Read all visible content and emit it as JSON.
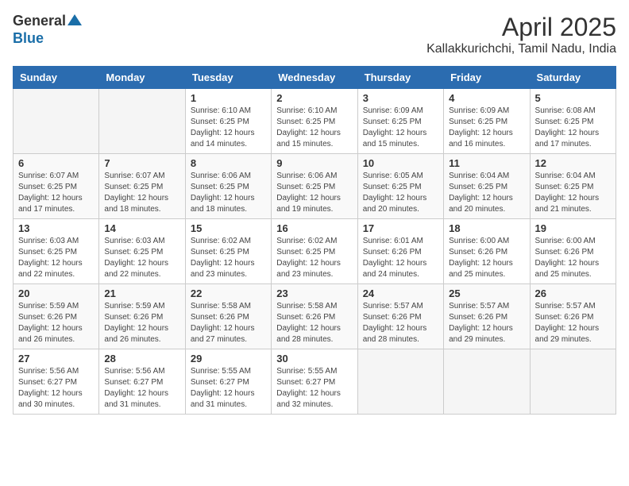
{
  "header": {
    "logo_general": "General",
    "logo_blue": "Blue",
    "month_year": "April 2025",
    "location": "Kallakkurichchi, Tamil Nadu, India"
  },
  "weekdays": [
    "Sunday",
    "Monday",
    "Tuesday",
    "Wednesday",
    "Thursday",
    "Friday",
    "Saturday"
  ],
  "weeks": [
    [
      {
        "day": "",
        "info": ""
      },
      {
        "day": "",
        "info": ""
      },
      {
        "day": "1",
        "info": "Sunrise: 6:10 AM\nSunset: 6:25 PM\nDaylight: 12 hours\nand 14 minutes."
      },
      {
        "day": "2",
        "info": "Sunrise: 6:10 AM\nSunset: 6:25 PM\nDaylight: 12 hours\nand 15 minutes."
      },
      {
        "day": "3",
        "info": "Sunrise: 6:09 AM\nSunset: 6:25 PM\nDaylight: 12 hours\nand 15 minutes."
      },
      {
        "day": "4",
        "info": "Sunrise: 6:09 AM\nSunset: 6:25 PM\nDaylight: 12 hours\nand 16 minutes."
      },
      {
        "day": "5",
        "info": "Sunrise: 6:08 AM\nSunset: 6:25 PM\nDaylight: 12 hours\nand 17 minutes."
      }
    ],
    [
      {
        "day": "6",
        "info": "Sunrise: 6:07 AM\nSunset: 6:25 PM\nDaylight: 12 hours\nand 17 minutes."
      },
      {
        "day": "7",
        "info": "Sunrise: 6:07 AM\nSunset: 6:25 PM\nDaylight: 12 hours\nand 18 minutes."
      },
      {
        "day": "8",
        "info": "Sunrise: 6:06 AM\nSunset: 6:25 PM\nDaylight: 12 hours\nand 18 minutes."
      },
      {
        "day": "9",
        "info": "Sunrise: 6:06 AM\nSunset: 6:25 PM\nDaylight: 12 hours\nand 19 minutes."
      },
      {
        "day": "10",
        "info": "Sunrise: 6:05 AM\nSunset: 6:25 PM\nDaylight: 12 hours\nand 20 minutes."
      },
      {
        "day": "11",
        "info": "Sunrise: 6:04 AM\nSunset: 6:25 PM\nDaylight: 12 hours\nand 20 minutes."
      },
      {
        "day": "12",
        "info": "Sunrise: 6:04 AM\nSunset: 6:25 PM\nDaylight: 12 hours\nand 21 minutes."
      }
    ],
    [
      {
        "day": "13",
        "info": "Sunrise: 6:03 AM\nSunset: 6:25 PM\nDaylight: 12 hours\nand 22 minutes."
      },
      {
        "day": "14",
        "info": "Sunrise: 6:03 AM\nSunset: 6:25 PM\nDaylight: 12 hours\nand 22 minutes."
      },
      {
        "day": "15",
        "info": "Sunrise: 6:02 AM\nSunset: 6:25 PM\nDaylight: 12 hours\nand 23 minutes."
      },
      {
        "day": "16",
        "info": "Sunrise: 6:02 AM\nSunset: 6:25 PM\nDaylight: 12 hours\nand 23 minutes."
      },
      {
        "day": "17",
        "info": "Sunrise: 6:01 AM\nSunset: 6:26 PM\nDaylight: 12 hours\nand 24 minutes."
      },
      {
        "day": "18",
        "info": "Sunrise: 6:00 AM\nSunset: 6:26 PM\nDaylight: 12 hours\nand 25 minutes."
      },
      {
        "day": "19",
        "info": "Sunrise: 6:00 AM\nSunset: 6:26 PM\nDaylight: 12 hours\nand 25 minutes."
      }
    ],
    [
      {
        "day": "20",
        "info": "Sunrise: 5:59 AM\nSunset: 6:26 PM\nDaylight: 12 hours\nand 26 minutes."
      },
      {
        "day": "21",
        "info": "Sunrise: 5:59 AM\nSunset: 6:26 PM\nDaylight: 12 hours\nand 26 minutes."
      },
      {
        "day": "22",
        "info": "Sunrise: 5:58 AM\nSunset: 6:26 PM\nDaylight: 12 hours\nand 27 minutes."
      },
      {
        "day": "23",
        "info": "Sunrise: 5:58 AM\nSunset: 6:26 PM\nDaylight: 12 hours\nand 28 minutes."
      },
      {
        "day": "24",
        "info": "Sunrise: 5:57 AM\nSunset: 6:26 PM\nDaylight: 12 hours\nand 28 minutes."
      },
      {
        "day": "25",
        "info": "Sunrise: 5:57 AM\nSunset: 6:26 PM\nDaylight: 12 hours\nand 29 minutes."
      },
      {
        "day": "26",
        "info": "Sunrise: 5:57 AM\nSunset: 6:26 PM\nDaylight: 12 hours\nand 29 minutes."
      }
    ],
    [
      {
        "day": "27",
        "info": "Sunrise: 5:56 AM\nSunset: 6:27 PM\nDaylight: 12 hours\nand 30 minutes."
      },
      {
        "day": "28",
        "info": "Sunrise: 5:56 AM\nSunset: 6:27 PM\nDaylight: 12 hours\nand 31 minutes."
      },
      {
        "day": "29",
        "info": "Sunrise: 5:55 AM\nSunset: 6:27 PM\nDaylight: 12 hours\nand 31 minutes."
      },
      {
        "day": "30",
        "info": "Sunrise: 5:55 AM\nSunset: 6:27 PM\nDaylight: 12 hours\nand 32 minutes."
      },
      {
        "day": "",
        "info": ""
      },
      {
        "day": "",
        "info": ""
      },
      {
        "day": "",
        "info": ""
      }
    ]
  ]
}
